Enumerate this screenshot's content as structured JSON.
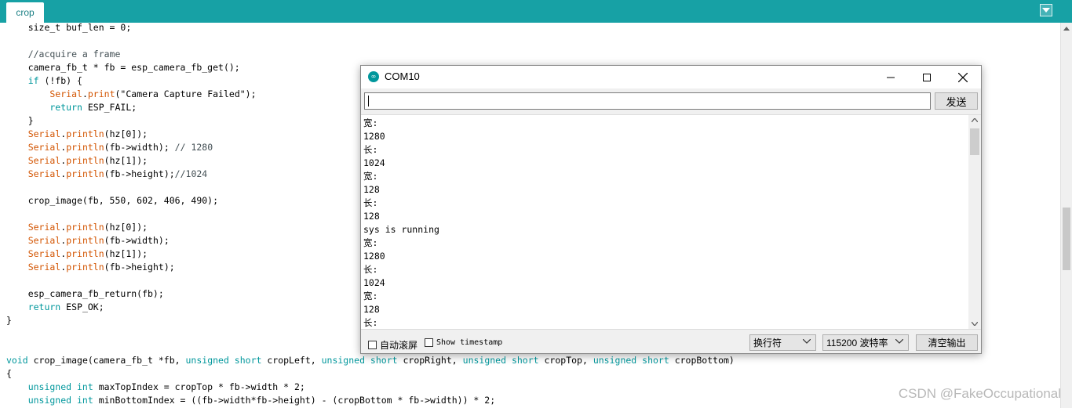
{
  "tabbar": {
    "tab_label": "crop",
    "menu_icon": "chevron-down-icon"
  },
  "editor": {
    "lines": [
      [
        {
          "t": "    size_t buf_len = 0;",
          "c": ""
        }
      ],
      [
        {
          "t": "",
          "c": ""
        }
      ],
      [
        {
          "t": "    //acquire a frame",
          "c": "cmt"
        }
      ],
      [
        {
          "t": "    camera_fb_t * fb = esp_camera_fb_get();",
          "c": ""
        }
      ],
      [
        {
          "t": "    if",
          "c": "type"
        },
        {
          "t": " (!fb) {",
          "c": ""
        }
      ],
      [
        {
          "t": "        Serial",
          "c": "fn"
        },
        {
          "t": ".",
          "c": ""
        },
        {
          "t": "print",
          "c": "fn"
        },
        {
          "t": "(\"Camera Capture Failed\");",
          "c": ""
        }
      ],
      [
        {
          "t": "        return",
          "c": "type"
        },
        {
          "t": " ESP_FAIL;",
          "c": ""
        }
      ],
      [
        {
          "t": "    }",
          "c": ""
        }
      ],
      [
        {
          "t": "    Serial",
          "c": "fn"
        },
        {
          "t": ".",
          "c": ""
        },
        {
          "t": "println",
          "c": "fn"
        },
        {
          "t": "(hz[0]);",
          "c": ""
        }
      ],
      [
        {
          "t": "    Serial",
          "c": "fn"
        },
        {
          "t": ".",
          "c": ""
        },
        {
          "t": "println",
          "c": "fn"
        },
        {
          "t": "(fb->width); ",
          "c": ""
        },
        {
          "t": "// 1280",
          "c": "cmt"
        }
      ],
      [
        {
          "t": "    Serial",
          "c": "fn"
        },
        {
          "t": ".",
          "c": ""
        },
        {
          "t": "println",
          "c": "fn"
        },
        {
          "t": "(hz[1]);",
          "c": ""
        }
      ],
      [
        {
          "t": "    Serial",
          "c": "fn"
        },
        {
          "t": ".",
          "c": ""
        },
        {
          "t": "println",
          "c": "fn"
        },
        {
          "t": "(fb->height);",
          "c": ""
        },
        {
          "t": "//1024",
          "c": "cmt"
        }
      ],
      [
        {
          "t": "",
          "c": ""
        }
      ],
      [
        {
          "t": "    crop_image(fb, 550, 602, 406, 490);",
          "c": ""
        }
      ],
      [
        {
          "t": "",
          "c": ""
        }
      ],
      [
        {
          "t": "    Serial",
          "c": "fn"
        },
        {
          "t": ".",
          "c": ""
        },
        {
          "t": "println",
          "c": "fn"
        },
        {
          "t": "(hz[0]);",
          "c": ""
        }
      ],
      [
        {
          "t": "    Serial",
          "c": "fn"
        },
        {
          "t": ".",
          "c": ""
        },
        {
          "t": "println",
          "c": "fn"
        },
        {
          "t": "(fb->width);",
          "c": ""
        }
      ],
      [
        {
          "t": "    Serial",
          "c": "fn"
        },
        {
          "t": ".",
          "c": ""
        },
        {
          "t": "println",
          "c": "fn"
        },
        {
          "t": "(hz[1]);",
          "c": ""
        }
      ],
      [
        {
          "t": "    Serial",
          "c": "fn"
        },
        {
          "t": ".",
          "c": ""
        },
        {
          "t": "println",
          "c": "fn"
        },
        {
          "t": "(fb->height);",
          "c": ""
        }
      ],
      [
        {
          "t": "",
          "c": ""
        }
      ],
      [
        {
          "t": "    esp_camera_fb_return(fb);",
          "c": ""
        }
      ],
      [
        {
          "t": "    return",
          "c": "type"
        },
        {
          "t": " ESP_OK;",
          "c": ""
        }
      ],
      [
        {
          "t": "}",
          "c": ""
        }
      ],
      [
        {
          "t": "",
          "c": ""
        }
      ],
      [
        {
          "t": "",
          "c": ""
        }
      ],
      [
        {
          "t": "void",
          "c": "type"
        },
        {
          "t": " crop_image(camera_fb_t *fb, ",
          "c": ""
        },
        {
          "t": "unsigned short",
          "c": "type"
        },
        {
          "t": " cropLeft, ",
          "c": ""
        },
        {
          "t": "unsigned short",
          "c": "type"
        },
        {
          "t": " cropRight, ",
          "c": ""
        },
        {
          "t": "unsigned short",
          "c": "type"
        },
        {
          "t": " cropTop, ",
          "c": ""
        },
        {
          "t": "unsigned short",
          "c": "type"
        },
        {
          "t": " cropBottom)",
          "c": ""
        }
      ],
      [
        {
          "t": "{",
          "c": ""
        }
      ],
      [
        {
          "t": "    unsigned int",
          "c": "type"
        },
        {
          "t": " maxTopIndex = cropTop * fb->width * 2;",
          "c": ""
        }
      ],
      [
        {
          "t": "    unsigned int",
          "c": "type"
        },
        {
          "t": " minBottomIndex = ((fb->width*fb->height) - (cropBottom * fb->width)) * 2;",
          "c": ""
        }
      ]
    ]
  },
  "watermark": "CSDN @FakeOccupational",
  "serial_monitor": {
    "title": "COM10",
    "input_value": "",
    "send_label": "发送",
    "output_lines": [
      "宽:",
      "1280",
      "长:",
      "1024",
      "宽:",
      "128",
      "长:",
      "128",
      "sys is running",
      "宽:",
      "1280",
      "长:",
      "1024",
      "宽:",
      "128",
      "长:"
    ],
    "autoscroll_label": "自动滚屏",
    "timestamp_label": "Show timestamp",
    "line_ending": "换行符",
    "baud_rate": "115200 波特率",
    "clear_label": "清空输出"
  },
  "colors": {
    "tabbar": "#17a1a5",
    "function": "#d35400",
    "keyword": "#00979c",
    "comment": "#434f54"
  }
}
